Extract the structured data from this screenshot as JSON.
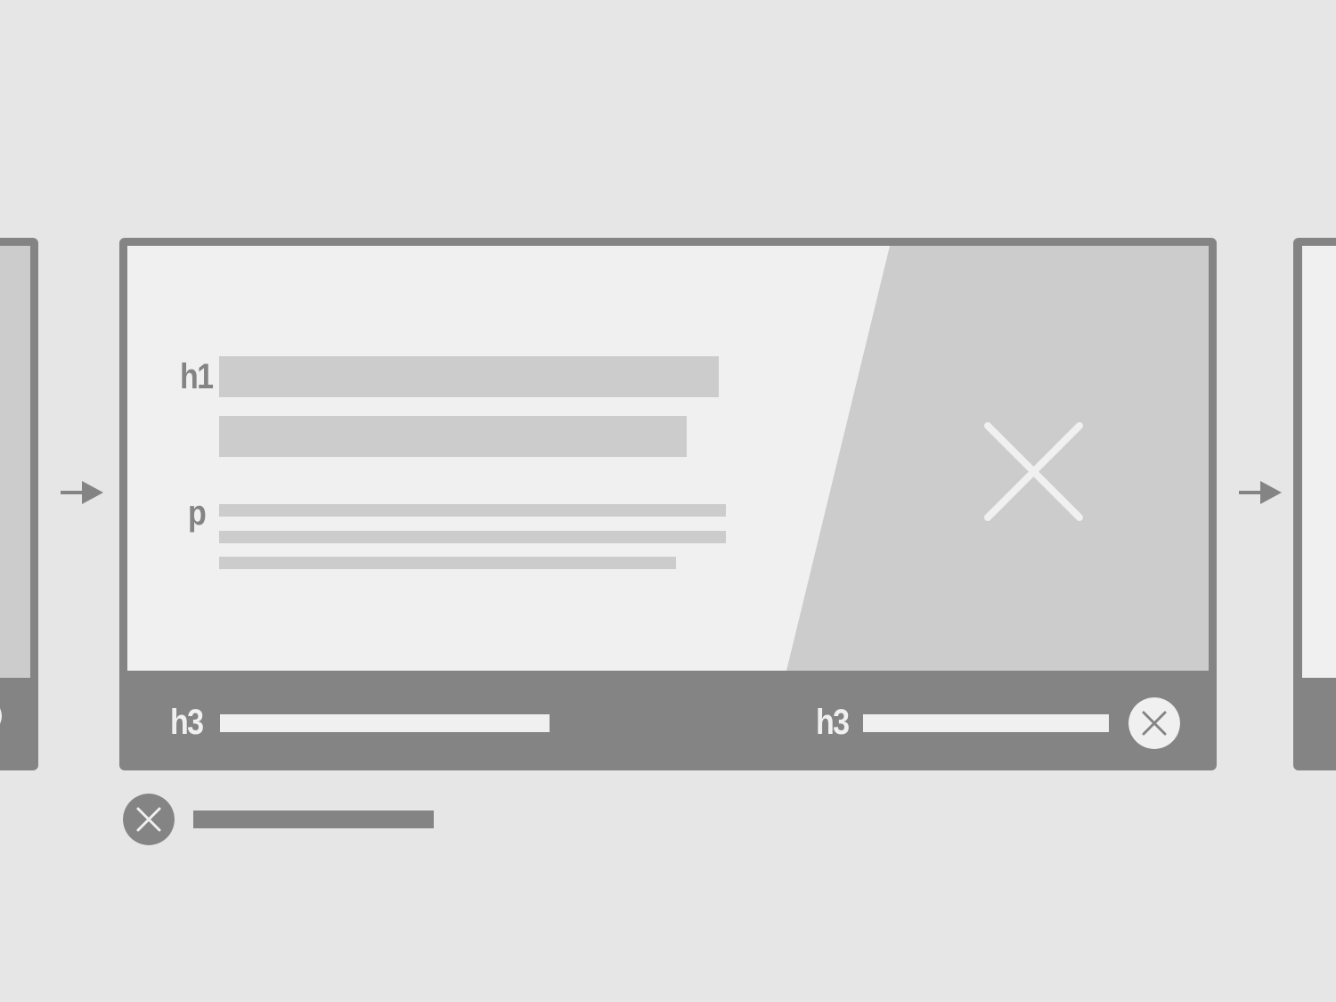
{
  "colors": {
    "background": "#e6e6e6",
    "frame": "#848484",
    "content_bg": "#f0f0f0",
    "placeholder": "#cccccc"
  },
  "slide": {
    "labels": {
      "heading": "h1",
      "paragraph": "p",
      "footer_left": "h3",
      "footer_right": "h3"
    },
    "icons": {
      "image_placeholder": "close-icon",
      "footer_button": "close-circle-icon",
      "caption_button": "close-circle-icon",
      "nav_arrow": "arrow-right-icon"
    }
  }
}
